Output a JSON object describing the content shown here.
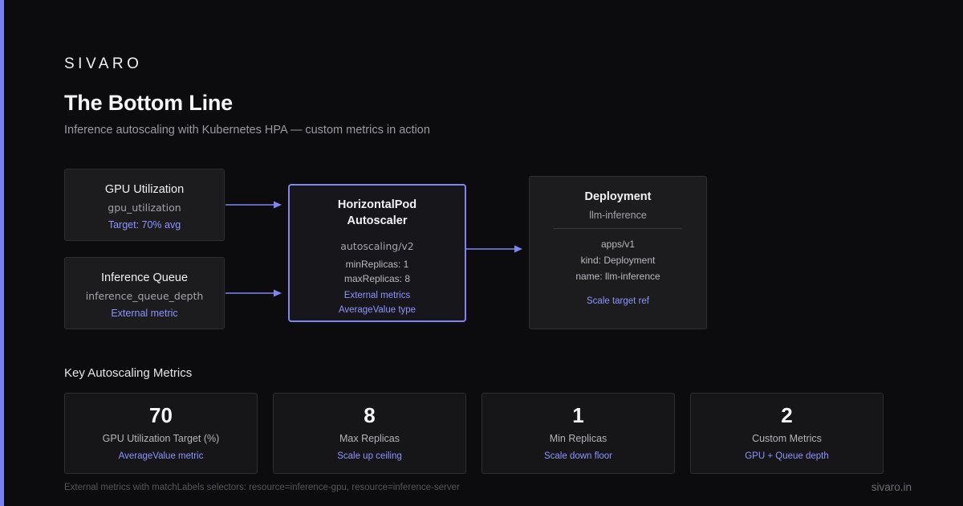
{
  "brand": "SIVARO",
  "header": {
    "title": "The Bottom Line",
    "subtitle": "Inference autoscaling with Kubernetes HPA — custom metrics in action"
  },
  "diagram": {
    "gpu_box": {
      "title": "GPU Utilization",
      "metric": "gpu_utilization",
      "note": "Target: 70% avg"
    },
    "queue_box": {
      "title": "Inference Queue",
      "metric": "inference_queue_depth",
      "note": "External metric"
    },
    "hpa_box": {
      "title_line1": "HorizontalPod",
      "title_line2": "Autoscaler",
      "api": "autoscaling/v2",
      "min": "minReplicas: 1",
      "max": "maxReplicas: 8",
      "note1": "External metrics",
      "note2": "AverageValue type"
    },
    "deployment_box": {
      "title": "Deployment",
      "name": "llm-inference",
      "api": "apps/v1",
      "kind": "kind: Deployment",
      "name_field": "name: llm-inference",
      "note": "Scale target ref"
    }
  },
  "metrics_section": {
    "heading": "Key Autoscaling Metrics",
    "cards": [
      {
        "value": "70",
        "label": "GPU Utilization Target (%)",
        "note": "AverageValue metric"
      },
      {
        "value": "8",
        "label": "Max Replicas",
        "note": "Scale up ceiling"
      },
      {
        "value": "1",
        "label": "Min Replicas",
        "note": "Scale down floor"
      },
      {
        "value": "2",
        "label": "Custom Metrics",
        "note": "GPU + Queue depth"
      }
    ]
  },
  "footer": {
    "note": "External metrics with matchLabels selectors: resource=inference-gpu, resource=inference-server",
    "site": "sivaro.in"
  },
  "colors": {
    "accent": "#8185f2",
    "background": "#0c0c0e",
    "card": "#1c1c1f"
  }
}
